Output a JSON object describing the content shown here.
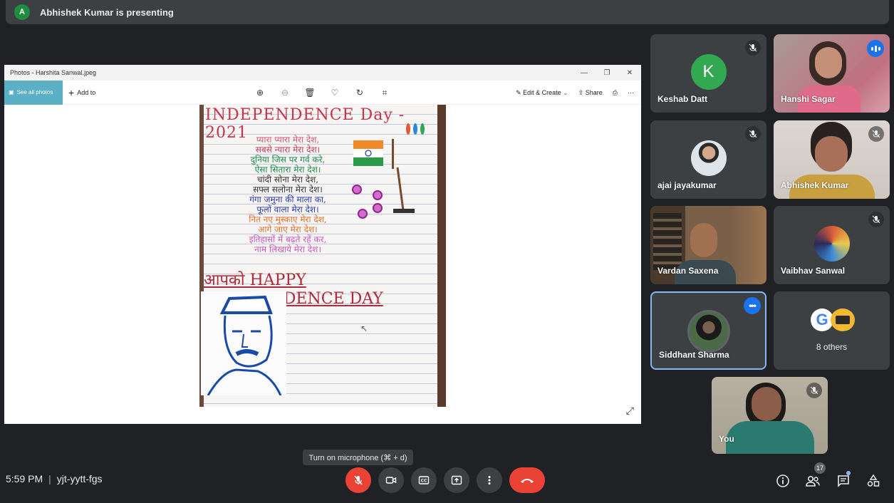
{
  "banner": {
    "avatar_letter": "A",
    "text": "Abhishek Kumar is presenting"
  },
  "photos_window": {
    "title": "Photos - Harshita Sanwal.jpeg",
    "see_all": "See all photos",
    "add_to": "Add to",
    "edit_create": "Edit & Create",
    "share": "Share",
    "poem_title": "INDEPENDENCE Day - 2021",
    "poem_lines": [
      "प्यारा प्यारा मेरा देश,",
      "सबसे न्यारा मेरा देश।",
      "दुनिया जिस पर गर्व करे,",
      "ऐसा सितारा मेरा देश।",
      "चांदी सोना मेरा देश,",
      "सफ्ल सलोना मेरा देश।",
      "गंगा जमुना की माला का,",
      "फूलों वाला मेरा देश।",
      "नित नए मुस्काए मेरा देश,",
      "आगे जाए मेरा देश।",
      "इतिहासों में बढ़ते रहें कर,",
      "नाम लिखाये मेरा देश।"
    ],
    "happy": "आपको HAPPY INDEPENDENCE DAY"
  },
  "participants": [
    {
      "name": "Keshab Datt",
      "initial": "K",
      "avatar_color": "#33a852",
      "muted": true
    },
    {
      "name": "Hanshi Sagar",
      "video": true,
      "speaking": true
    },
    {
      "name": "ajai jayakumar",
      "muted": true
    },
    {
      "name": "Abhishek Kumar",
      "video": true,
      "muted": true
    },
    {
      "name": "Vardan Saxena",
      "video": true
    },
    {
      "name": "Vaibhav Sanwal",
      "muted": true
    },
    {
      "name": "Siddhant Sharma",
      "highlighted": true
    },
    {
      "name": "8 others"
    },
    {
      "name": "You",
      "video": true,
      "muted": true
    }
  ],
  "tooltip": "Turn on microphone (⌘ + d)",
  "meeting": {
    "time": "5:59 PM",
    "separator": "|",
    "code": "yjt-yytt-fgs"
  },
  "people_count": "17",
  "colors": {
    "end_call": "#ea4335",
    "accent": "#1a73e8",
    "highlight": "#8ab4f8"
  }
}
